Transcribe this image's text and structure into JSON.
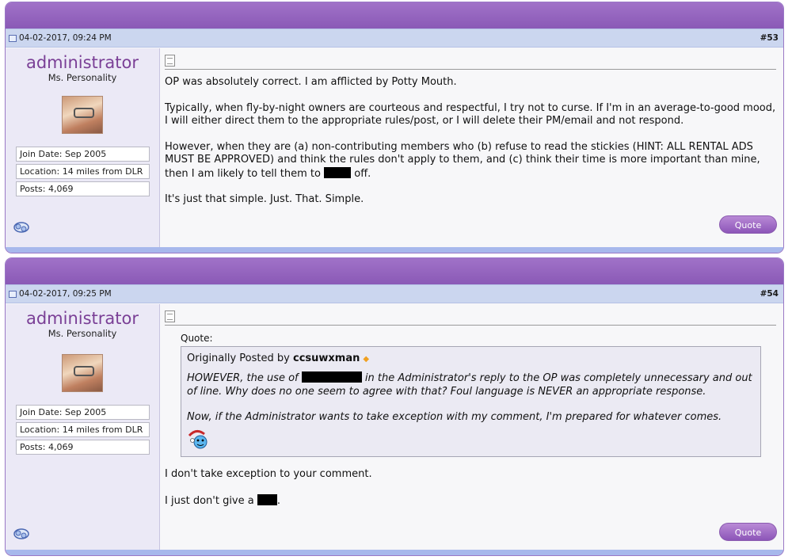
{
  "posts": [
    {
      "date": "04-02-2017, 09:24 PM",
      "number_hash": "#",
      "number": "53",
      "username": "administrator",
      "user_title": "Ms. Personality",
      "join_date": "Join Date: Sep 2005",
      "location": "Location: 14 miles from DLR",
      "posts": "Posts: 4,069",
      "quote_label": "Quote",
      "paragraphs": [
        "OP was absolutely correct. I am afflicted by Potty Mouth.",
        "Typically, when fly-by-night owners are courteous and respectful, I try not to curse. If I'm in an average-to-good mood, I will either direct them to the appropriate rules/post, or I will delete their PM/email and not respond.",
        "However, when they are (a) non-contributing members who (b) refuse to read the stickies (HINT: ALL RENTAL ADS MUST BE APPROVED) and think the rules don't apply to them, and (c) think their time is more important than mine, then I am likely to tell them to",
        "off.",
        "It's just that simple. Just. That. Simple."
      ]
    },
    {
      "date": "04-02-2017, 09:25 PM",
      "number_hash": "#",
      "number": "54",
      "username": "administrator",
      "user_title": "Ms. Personality",
      "join_date": "Join Date: Sep 2005",
      "location": "Location: 14 miles from DLR",
      "posts": "Posts: 4,069",
      "quote_label": "Quote",
      "quote_heading": "Quote:",
      "quote_posted_by": "Originally Posted by",
      "quote_author": "ccsuwxman",
      "quote_paragraphs": [
        "HOWEVER, the use of",
        "in the Administrator's reply to the OP was completely unnecessary and out of line. Why does no one seem to agree with that? Foul language is NEVER an appropriate response.",
        "Now, if the Administrator wants to take exception with my comment, I'm prepared for whatever comes."
      ],
      "paragraphs": [
        "I don't take exception to your comment.",
        "I just don't give a",
        "."
      ]
    }
  ],
  "colors": {
    "header_purple": "#8a59b6",
    "date_bar": "#cbd6ef",
    "username": "#7a3f96",
    "quote_button": "#a070c8"
  },
  "icons": [
    "post-icon",
    "message-icon",
    "online-status-icon",
    "diamond-icon",
    "smiley-icon"
  ]
}
